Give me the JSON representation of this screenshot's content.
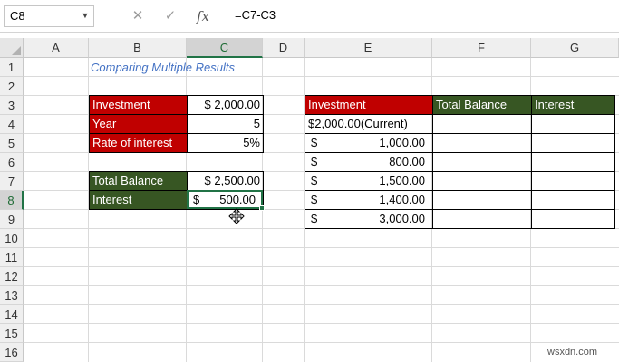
{
  "formula_bar": {
    "name_box": "C8",
    "formula": "=C7-C3",
    "cancel_glyph": "✕",
    "enter_glyph": "✓",
    "fx_label": "fx"
  },
  "columns": [
    "A",
    "B",
    "C",
    "D",
    "E",
    "F",
    "G"
  ],
  "rows": [
    "1",
    "2",
    "3",
    "4",
    "5",
    "6",
    "7",
    "8",
    "9",
    "10",
    "11",
    "12",
    "13",
    "14",
    "15",
    "16"
  ],
  "sheet": {
    "title": "Comparing Multiple Results",
    "left_table": {
      "investment_label": "Investment",
      "investment_value": "$ 2,000.00",
      "year_label": "Year",
      "year_value": "5",
      "rate_label": "Rate of interest",
      "rate_value": "5%"
    },
    "result_table": {
      "total_balance_label": "Total Balance",
      "total_balance_value": "$ 2,500.00",
      "interest_label": "Interest",
      "interest_currency": "$",
      "interest_value": "500.00"
    },
    "right_table": {
      "headers": [
        "Investment",
        "Total Balance",
        "Interest"
      ],
      "first_row": "$2,000.00(Current)",
      "currency": "$",
      "values": [
        "1,000.00",
        "800.00",
        "1,500.00",
        "1,400.00",
        "3,000.00"
      ]
    }
  },
  "watermark": "wsxdn.com",
  "colors": {
    "accent_green": "#217346",
    "header_red": "#c00000",
    "header_green": "#375623",
    "title_blue": "#4472c4"
  }
}
